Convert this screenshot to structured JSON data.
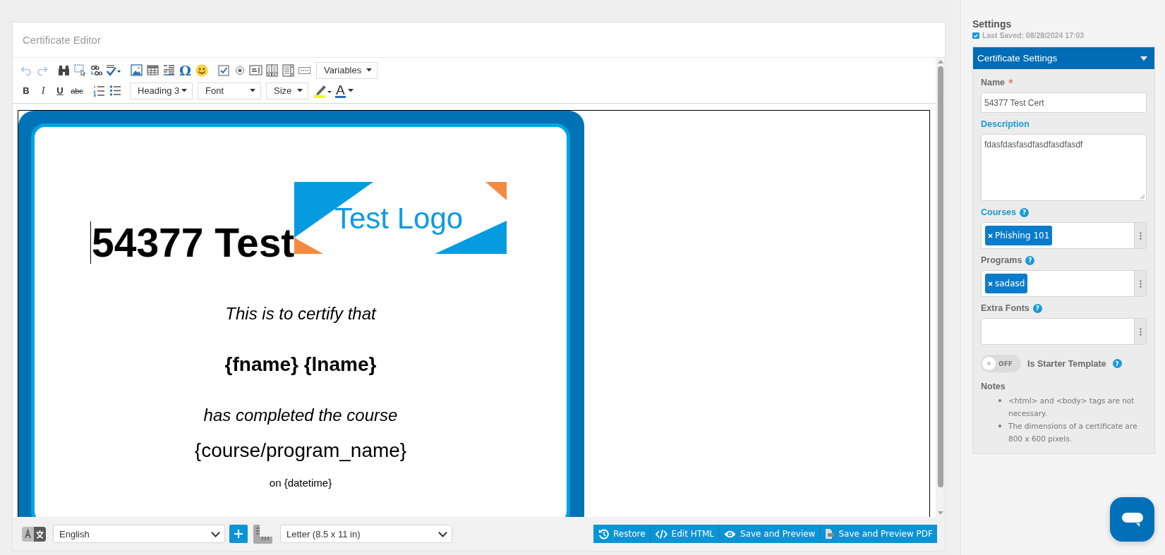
{
  "editor": {
    "title": "Certificate Editor",
    "toolbar": {
      "history": [
        {
          "kind": "undo",
          "disabled": true
        },
        {
          "kind": "redo",
          "disabled": true
        }
      ],
      "special_char": "Ω",
      "variables": "Variables",
      "format_buttons": [
        {
          "kind": "bold",
          "label": "B"
        },
        {
          "kind": "italic",
          "label": "I"
        },
        {
          "kind": "underline",
          "label": "U"
        },
        {
          "kind": "strike",
          "label": "abc"
        }
      ],
      "dropdowns": [
        "Heading 3",
        "Font",
        "Size"
      ],
      "font_color": "A"
    },
    "document": {
      "title": "54377 Test",
      "logo_text": "Test Logo",
      "lines": [
        {
          "kind": "italic",
          "text": "This is to certify that"
        },
        {
          "kind": "bold",
          "text": "{fname} {lname}"
        },
        {
          "kind": "italic",
          "text": "has completed the course"
        },
        {
          "kind": "large",
          "text": "{course/program_name}"
        },
        {
          "kind": "small",
          "text": "on {datetime}"
        }
      ]
    },
    "language_select": "English",
    "page_size_select": "Letter (8.5 x 11 in)",
    "actions": [
      {
        "kind": "restore",
        "label": "Restore"
      },
      {
        "kind": "code",
        "label": "Edit HTML"
      },
      {
        "kind": "preview",
        "label": "Save and Preview"
      },
      {
        "kind": "pdf",
        "label": "Save and Preview PDF"
      }
    ]
  },
  "settings": {
    "title": "Settings",
    "last_saved": "Last Saved: 08/28/2024 17:03",
    "section": {
      "title": "Certificate Settings",
      "expanded": true,
      "name": {
        "label": "Name",
        "required": true,
        "required_mark": "*",
        "highlighted": false,
        "value": "54377 Test Cert"
      },
      "description": {
        "label": "Description",
        "highlighted": true,
        "value": "fdasfdasfasdfasdfasdfasdf"
      },
      "multiselects": [
        {
          "label": "Courses",
          "highlighted": true,
          "help": "?",
          "tags": [
            "Phishing 101"
          ]
        },
        {
          "label": "Programs",
          "highlighted": false,
          "help": "?",
          "tags": [
            "sadasd"
          ]
        },
        {
          "label": "Extra Fonts",
          "highlighted": false,
          "help": "?"
        }
      ],
      "starter_template": {
        "label": "Is Starter Template",
        "on": false,
        "toggle_text": "OFF",
        "help": "?"
      },
      "notes": {
        "title": "Notes",
        "items": [
          "<html> and <body> tags are not necessary.",
          "The dimensions of a certificate are 800 x 600 pixels."
        ]
      }
    }
  }
}
